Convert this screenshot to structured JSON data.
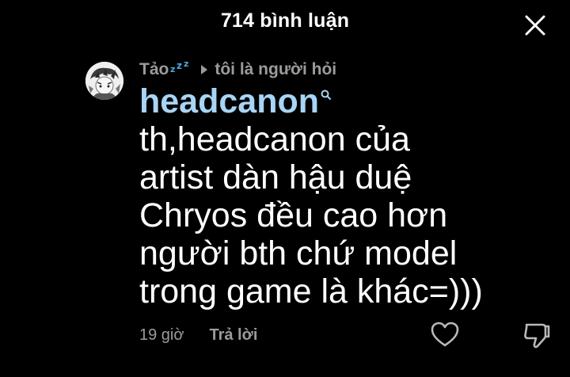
{
  "header": {
    "title": "714 bình luận",
    "close_icon": "close-icon"
  },
  "comment": {
    "avatar_icon": "user-avatar",
    "author": "Tảo",
    "author_badge_icon": "zzz-icon",
    "reply_indicator_icon": "reply-arrow-icon",
    "reply_to": "tôi là người hỏi",
    "mention": "headcanon",
    "mention_icon": "search-icon",
    "lines": [
      "th,headcanon của",
      "artist dàn hậu duệ",
      "Chryos đều cao hơn",
      "người bth chứ model",
      "trong game là khác=)))"
    ],
    "timestamp": "19 giờ",
    "reply_label": "Trả lời",
    "like_icon": "heart-icon",
    "dislike_icon": "thumbs-down-icon"
  },
  "colors": {
    "background": "#000000",
    "text": "#ffffff",
    "muted": "#9b9b9b",
    "mention": "#a8d4f5",
    "badge": "#4aa8e0"
  }
}
